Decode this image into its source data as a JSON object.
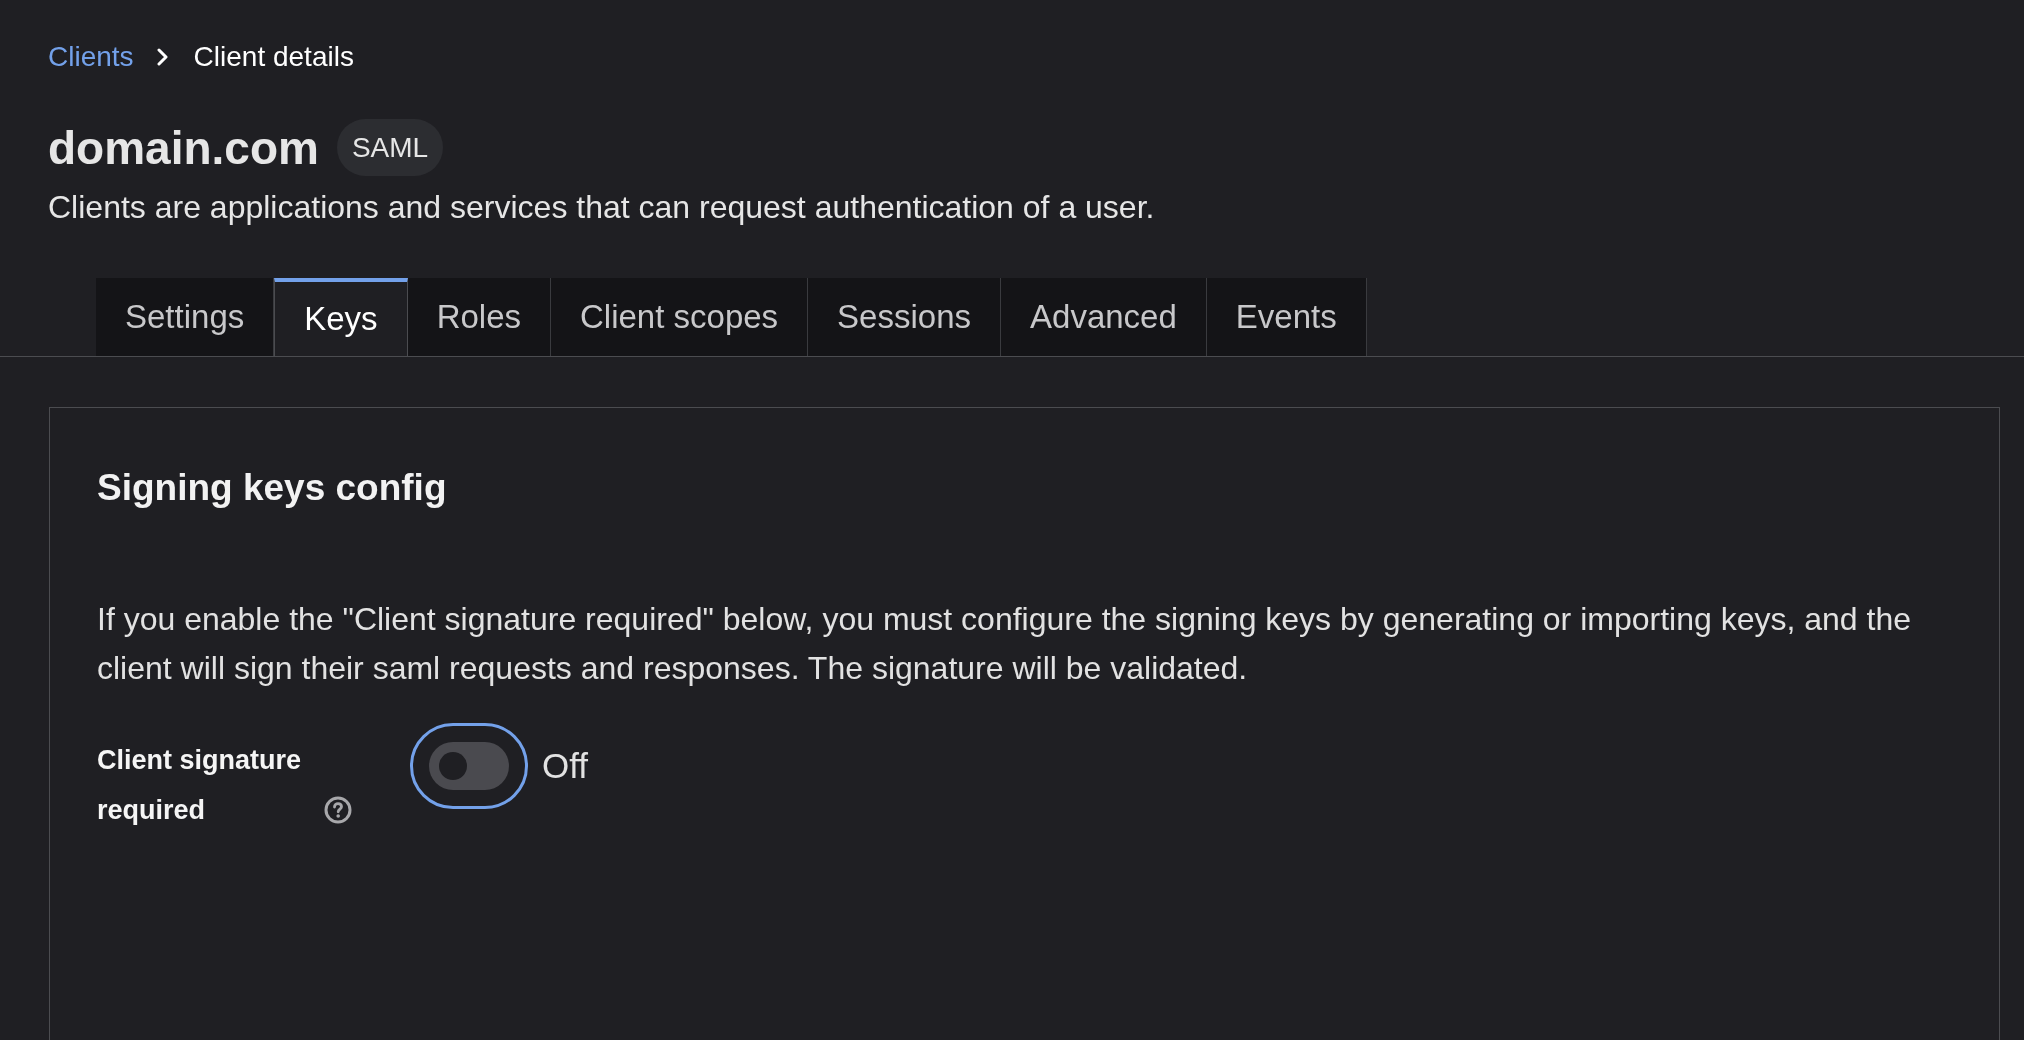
{
  "breadcrumb": [
    {
      "label": "Clients",
      "kind": "link"
    },
    {
      "label": "Client details",
      "kind": "current"
    }
  ],
  "header": {
    "title": "domain.com",
    "badge": "SAML",
    "description": "Clients are applications and services that can request authentication of a user."
  },
  "tabs": [
    {
      "label": "Settings",
      "selected": false
    },
    {
      "label": "Keys",
      "selected": true
    },
    {
      "label": "Roles",
      "selected": false
    },
    {
      "label": "Client scopes",
      "selected": false
    },
    {
      "label": "Sessions",
      "selected": false
    },
    {
      "label": "Advanced",
      "selected": false
    },
    {
      "label": "Events",
      "selected": false
    }
  ],
  "card": {
    "title": "Signing keys config",
    "description": "If you enable the \"Client signature required\" below, you must configure the signing keys by generating or importing keys, and the client will sign their saml requests and responses. The signature will be validated.",
    "fields": [
      {
        "kind": "switch",
        "label": "Client signature required",
        "on": false,
        "status": "Off"
      }
    ]
  }
}
